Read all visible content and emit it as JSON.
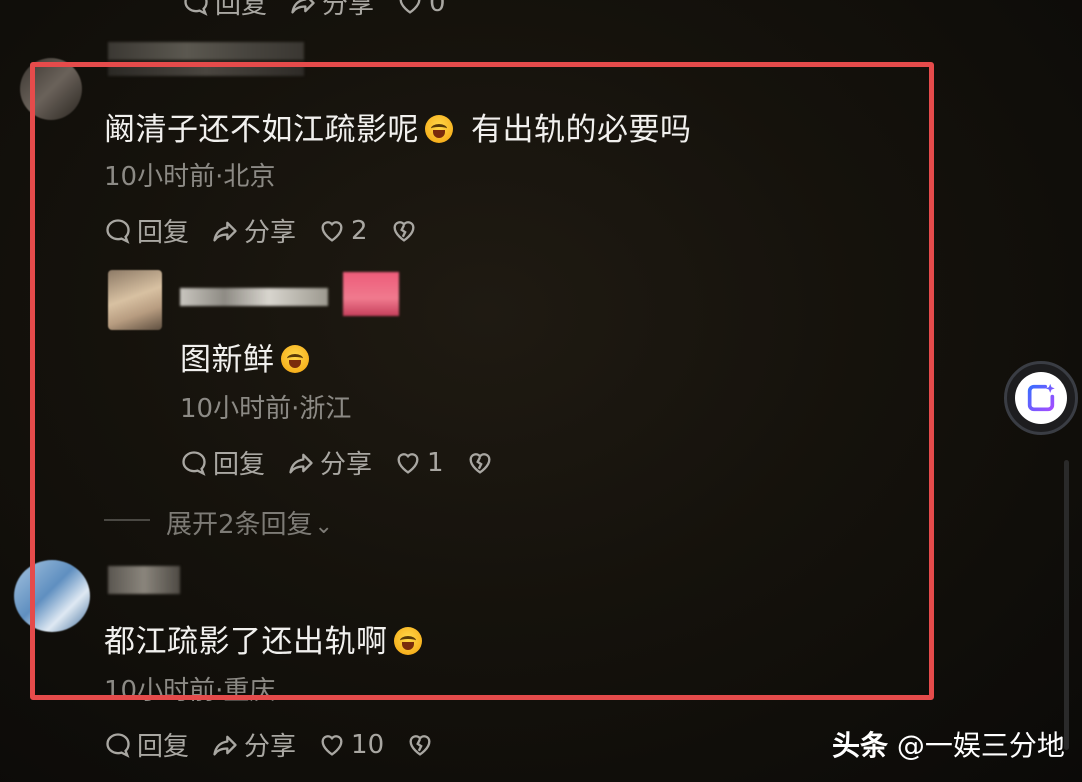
{
  "top_actions": {
    "reply": "回复",
    "share": "分享",
    "likes": "0"
  },
  "comments": [
    {
      "text": "阚清子还不如江疏影呢",
      "text_after_emoji": "有出轨的必要吗",
      "meta": "10小时前·北京",
      "actions": {
        "reply": "回复",
        "share": "分享",
        "likes": "2"
      }
    },
    {
      "text": "图新鲜",
      "meta": "10小时前·浙江",
      "actions": {
        "reply": "回复",
        "share": "分享",
        "likes": "1"
      }
    },
    {
      "text": "都江疏影了还出轨啊",
      "meta": "10小时前·重庆",
      "actions": {
        "reply": "回复",
        "share": "分享",
        "likes": "10"
      }
    }
  ],
  "expand_replies": "展开2条回复",
  "watermark": {
    "platform": "头条",
    "author": "@一娱三分地"
  },
  "colors": {
    "highlight_border": "#e54b4b",
    "background": "#14110c",
    "meta_text": "#8c8a85"
  }
}
